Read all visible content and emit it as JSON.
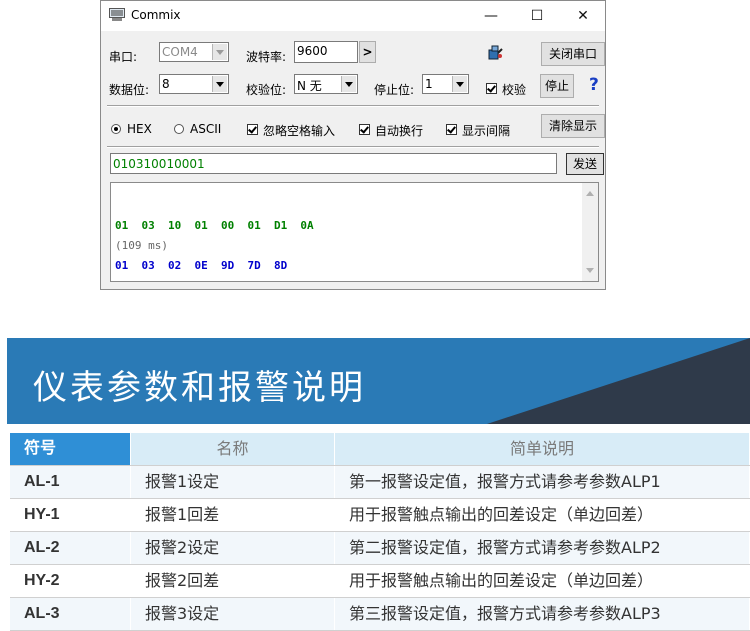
{
  "window": {
    "title": "Commix",
    "minimize": "—",
    "maximize": "☐",
    "close": "✕",
    "port_label": "串口:",
    "port_value": "COM4",
    "baud_label": "波特率:",
    "baud_value": "9600",
    "baud_more": ">",
    "close_port_btn": "关闭串口",
    "databits_label": "数据位:",
    "databits_value": "8",
    "parity_label": "校验位:",
    "parity_value": "N 无",
    "stopbits_label": "停止位:",
    "stopbits_value": "1",
    "checksum_label": "校验",
    "checksum_checked": true,
    "stop_btn": "停止",
    "help": "?",
    "hex_label": "HEX",
    "hex_selected": true,
    "ascii_label": "ASCII",
    "ignore_space_label": "忽略空格输入",
    "auto_newline_label": "自动换行",
    "show_interval_label": "显示间隔",
    "clear_btn": "清除显示",
    "send_value": "010310010001",
    "send_btn": "发送",
    "recv_lines": [
      {
        "text": "01  03  10  01  00  01  D1  0A",
        "color": "#008000"
      },
      {
        "text": "(109 ms)",
        "color": "#666666"
      },
      {
        "text": "01  03  02  0E  9D  7D  8D",
        "color": "#0000cc"
      }
    ]
  },
  "banner": {
    "title": "仪表参数和报警说明"
  },
  "table": {
    "headers": [
      "符号",
      "名称",
      "简单说明"
    ],
    "rows": [
      [
        "AL-1",
        "报警1设定",
        "第一报警设定值，报警方式请参考参数ALP1"
      ],
      [
        "HY-1",
        "报警1回差",
        "用于报警触点输出的回差设定（单边回差）"
      ],
      [
        "AL-2",
        "报警2设定",
        "第二报警设定值，报警方式请参考参数ALP2"
      ],
      [
        "HY-2",
        "报警2回差",
        "用于报警触点输出的回差设定（单边回差）"
      ],
      [
        "AL-3",
        "报警3设定",
        "第三报警设定值，报警方式请参考参数ALP3"
      ]
    ]
  }
}
